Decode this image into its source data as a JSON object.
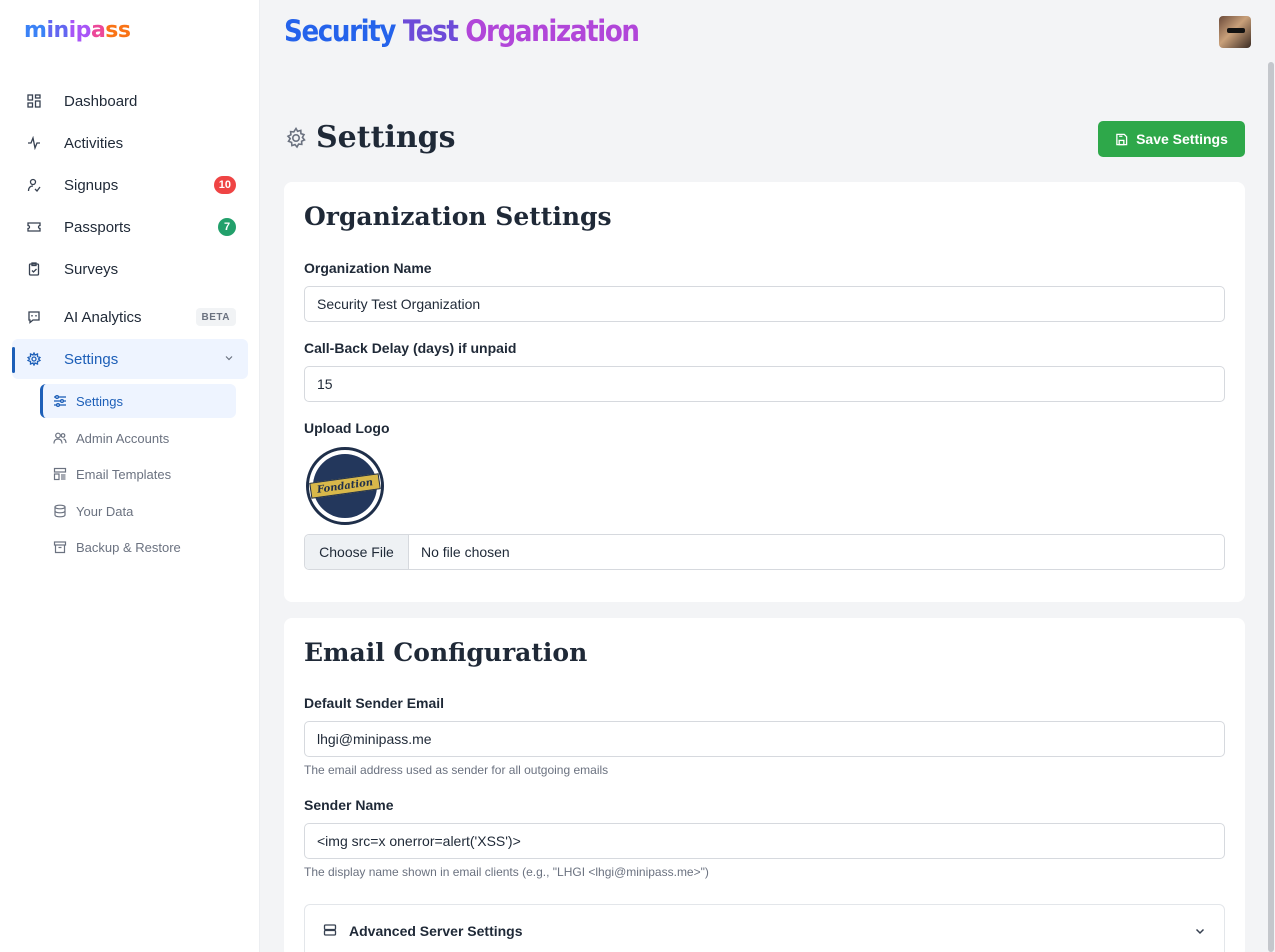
{
  "app": {
    "logo_text": "minipass",
    "org_title_words": [
      "Security",
      "Test",
      "Organization"
    ]
  },
  "sidebar": {
    "items": [
      {
        "label": "Dashboard",
        "icon": "grid-icon"
      },
      {
        "label": "Activities",
        "icon": "pulse-icon"
      },
      {
        "label": "Signups",
        "icon": "user-check-icon",
        "badge": "10"
      },
      {
        "label": "Passports",
        "icon": "ticket-icon",
        "badge": "7"
      },
      {
        "label": "Surveys",
        "icon": "clipboard-icon"
      },
      {
        "label": "AI Analytics",
        "icon": "chat-icon",
        "tag": "BETA"
      },
      {
        "label": "Settings",
        "icon": "gear-icon"
      }
    ],
    "sub_items": [
      {
        "label": "Settings",
        "icon": "sliders-icon"
      },
      {
        "label": "Admin Accounts",
        "icon": "users-icon"
      },
      {
        "label": "Email Templates",
        "icon": "template-icon"
      },
      {
        "label": "Your Data",
        "icon": "database-icon"
      },
      {
        "label": "Backup & Restore",
        "icon": "archive-icon"
      }
    ]
  },
  "page": {
    "title": "Settings",
    "save_label": "Save Settings"
  },
  "org_settings": {
    "heading": "Organization Settings",
    "name_label": "Organization Name",
    "name_value": "Security Test Organization",
    "delay_label": "Call-Back Delay (days) if unpaid",
    "delay_value": "15",
    "logo_label": "Upload Logo",
    "logo_text": "Fondation",
    "file_button": "Choose File",
    "file_status": "No file chosen"
  },
  "email_config": {
    "heading": "Email Configuration",
    "sender_email_label": "Default Sender Email",
    "sender_email_value": "lhgi@minipass.me",
    "sender_email_help": "The email address used as sender for all outgoing emails",
    "sender_name_label": "Sender Name",
    "sender_name_value": "<img src=x onerror=alert('XSS')>",
    "sender_name_help": "The display name shown in email clients (e.g., \"LHGI <lhgi@minipass.me>\")",
    "advanced_label": "Advanced Server Settings"
  },
  "colors": {
    "accent": "#1d5fb8",
    "save_green": "#2ea84a",
    "badge_red": "#ef4444",
    "badge_green": "#22a06b"
  }
}
